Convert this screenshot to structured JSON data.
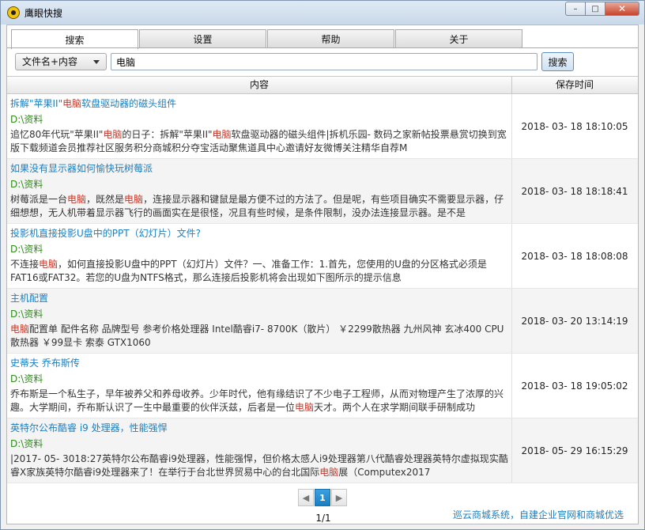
{
  "window": {
    "title": "鹰眼快搜",
    "minimize_glyph": "–",
    "maximize_glyph": "□",
    "close_glyph": "✕"
  },
  "tabs": [
    {
      "label": "搜索",
      "active": true
    },
    {
      "label": "设置",
      "active": false
    },
    {
      "label": "帮助",
      "active": false
    },
    {
      "label": "关于",
      "active": false
    }
  ],
  "search": {
    "mode_selected": "文件名+内容",
    "query": "电脑",
    "button_label": "搜索"
  },
  "table": {
    "headers": {
      "content": "内容",
      "time": "保存时间"
    },
    "highlight_color": "#c0392b",
    "rows": [
      {
        "title": [
          {
            "t": "拆解\"苹果II\""
          },
          {
            "t": "电脑",
            "hl": true
          },
          {
            "t": "软盘驱动器的磁头组件"
          }
        ],
        "path": "D:\\资料",
        "snippet": [
          {
            "t": "追忆80年代玩\"苹果II\""
          },
          {
            "t": "电脑",
            "hl": true
          },
          {
            "t": "的日子：拆解\"苹果II\""
          },
          {
            "t": "电脑",
            "hl": true
          },
          {
            "t": "软盘驱动器的磁头组件|拆机乐园- 数码之家新帖投票悬赏切换到宽版下载频道会员推荐社区服务积分商城积分夺宝活动聚焦道具中心邀请好友微博关注精华自荐M"
          }
        ],
        "time": "2018- 03- 18 18:10:05"
      },
      {
        "title": [
          {
            "t": "如果没有显示器如何愉快玩树莓派"
          }
        ],
        "path": "D:\\资料",
        "snippet": [
          {
            "t": "树莓派是一台"
          },
          {
            "t": "电脑",
            "hl": true
          },
          {
            "t": "，既然是"
          },
          {
            "t": "电脑",
            "hl": true
          },
          {
            "t": "，连接显示器和键鼠是最方便不过的方法了。但是呢，有些项目确实不需要显示器，仔细想想，无人机带着显示器飞行的画面实在是很怪，况且有些时候，是条件限制，没办法连接显示器。是不是"
          }
        ],
        "time": "2018- 03- 18 18:18:41"
      },
      {
        "title": [
          {
            "t": "投影机直接投影U盘中的PPT（幻灯片）文件?"
          }
        ],
        "path": "D:\\资料",
        "snippet": [
          {
            "t": "不连接"
          },
          {
            "t": "电脑",
            "hl": true
          },
          {
            "t": "，如何直接投影U盘中的PPT（幻灯片）文件？一、准备工作：1.首先，您使用的U盘的分区格式必须是FAT16或FAT32。若您的U盘为NTFS格式，那么连接后投影机将会出现如下图所示的提示信息"
          }
        ],
        "time": "2018- 03- 18 18:08:08"
      },
      {
        "title": [
          {
            "t": "主机配置"
          }
        ],
        "path": "D:\\资料",
        "snippet": [
          {
            "t": "电脑",
            "hl": true
          },
          {
            "t": "配置单  配件名称  品牌型号  参考价格处理器  Intel酷睿i7- 8700K（散片）  ￥2299散热器  九州风神 玄冰400 CPU散热器  ￥99显卡  索泰  GTX1060"
          }
        ],
        "time": "2018- 03- 20 13:14:19"
      },
      {
        "title": [
          {
            "t": "史蒂夫 乔布斯传"
          }
        ],
        "path": "D:\\资料",
        "snippet": [
          {
            "t": "乔布斯是一个私生子，早年被养父和养母收养。少年时代，他有缘结识了不少电子工程师，从而对物理产生了浓厚的兴趣。大学期间，乔布斯认识了一生中最重要的伙伴沃兹，后者是一位"
          },
          {
            "t": "电脑",
            "hl": true
          },
          {
            "t": "天才。两个人在求学期间联手研制成功"
          }
        ],
        "time": "2018- 03- 18 19:05:02"
      },
      {
        "title": [
          {
            "t": "英特尔公布酷睿 i9 处理器，性能强悍"
          }
        ],
        "path": "D:\\资料",
        "snippet": [
          {
            "t": "|2017- 05- 3018:27英特尔公布酷睿i9处理器，性能强悍，但价格太感人i9处理器第八代酷睿处理器英特尔虚拟现实酷睿X家族英特尔酷睿i9处理器来了！在举行于台北世界贸易中心的台北国际"
          },
          {
            "t": "电脑",
            "hl": true
          },
          {
            "t": "展（Computex2017"
          }
        ],
        "time": "2018- 05- 29 16:15:29"
      }
    ]
  },
  "pagination": {
    "prev_glyph": "◀",
    "next_glyph": "▶",
    "current_page": "1",
    "page_count": "1/1"
  },
  "footer": {
    "link_text": "巡云商城系统，自建企业官网和商城优选"
  }
}
